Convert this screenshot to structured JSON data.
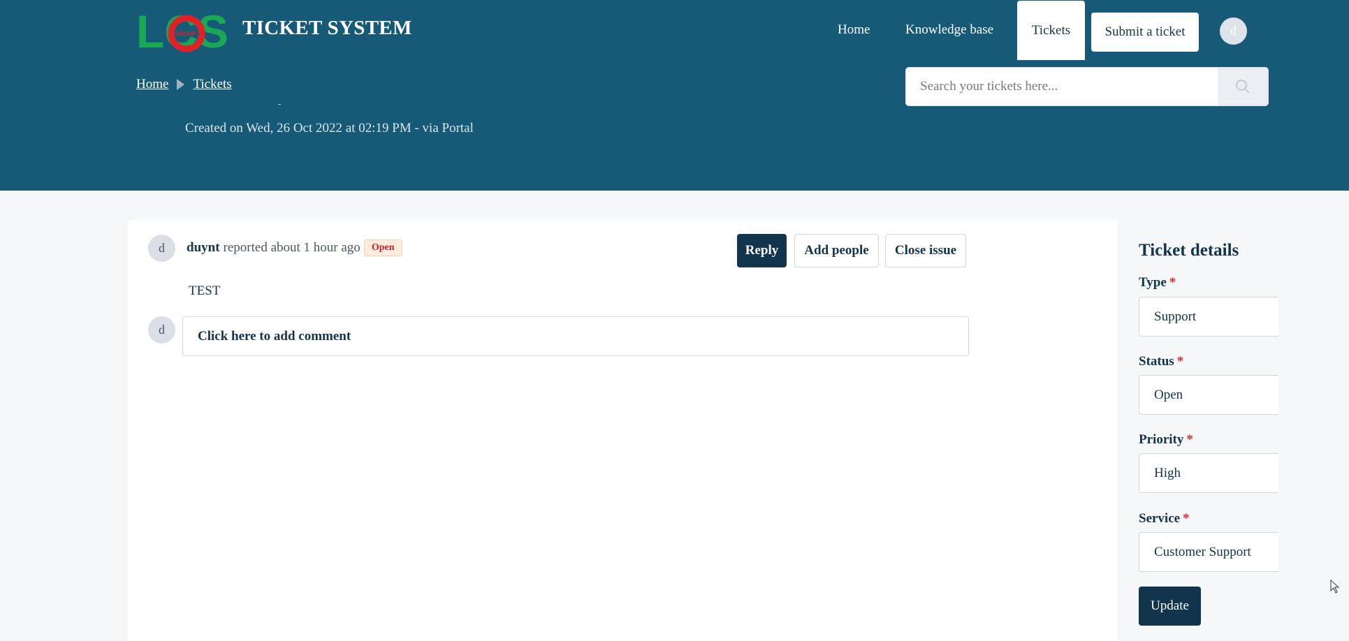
{
  "brand": {
    "logo_text": "LCS",
    "logo_sub": "GROUP",
    "title": "TICKET SYSTEM"
  },
  "nav": {
    "home": "Home",
    "knowledge_base": "Knowledge base",
    "tickets": "Tickets",
    "submit": "Submit a ticket",
    "avatar_initial": "d"
  },
  "breadcrumb": {
    "home": "Home",
    "tickets": "Tickets"
  },
  "search": {
    "placeholder": "Search your tickets here...",
    "icon": "search-icon"
  },
  "ticket": {
    "created": "Created on Wed, 26 Oct 2022 at 02:19 PM - via Portal",
    "reporter": "duynt",
    "reported_text": "reported about 1 hour ago",
    "status_badge": "Open",
    "avatar_initial": "d",
    "body": "TEST",
    "comment_placeholder": "Click here to add comment",
    "commenter_initial": "d"
  },
  "actions": {
    "reply": "Reply",
    "add_people": "Add people",
    "close_issue": "Close issue"
  },
  "details": {
    "title": "Ticket details",
    "required_mark": "*",
    "fields": [
      {
        "label": "Type",
        "value": "Support"
      },
      {
        "label": "Status",
        "value": "Open"
      },
      {
        "label": "Priority",
        "value": "High"
      },
      {
        "label": "Service",
        "value": "Customer Support"
      }
    ],
    "update": "Update"
  },
  "colors": {
    "header_bg": "#175a78",
    "primary": "#12344d",
    "badge_bg": "#ffecdf",
    "badge_text": "#c82124",
    "required": "#d72d30"
  }
}
